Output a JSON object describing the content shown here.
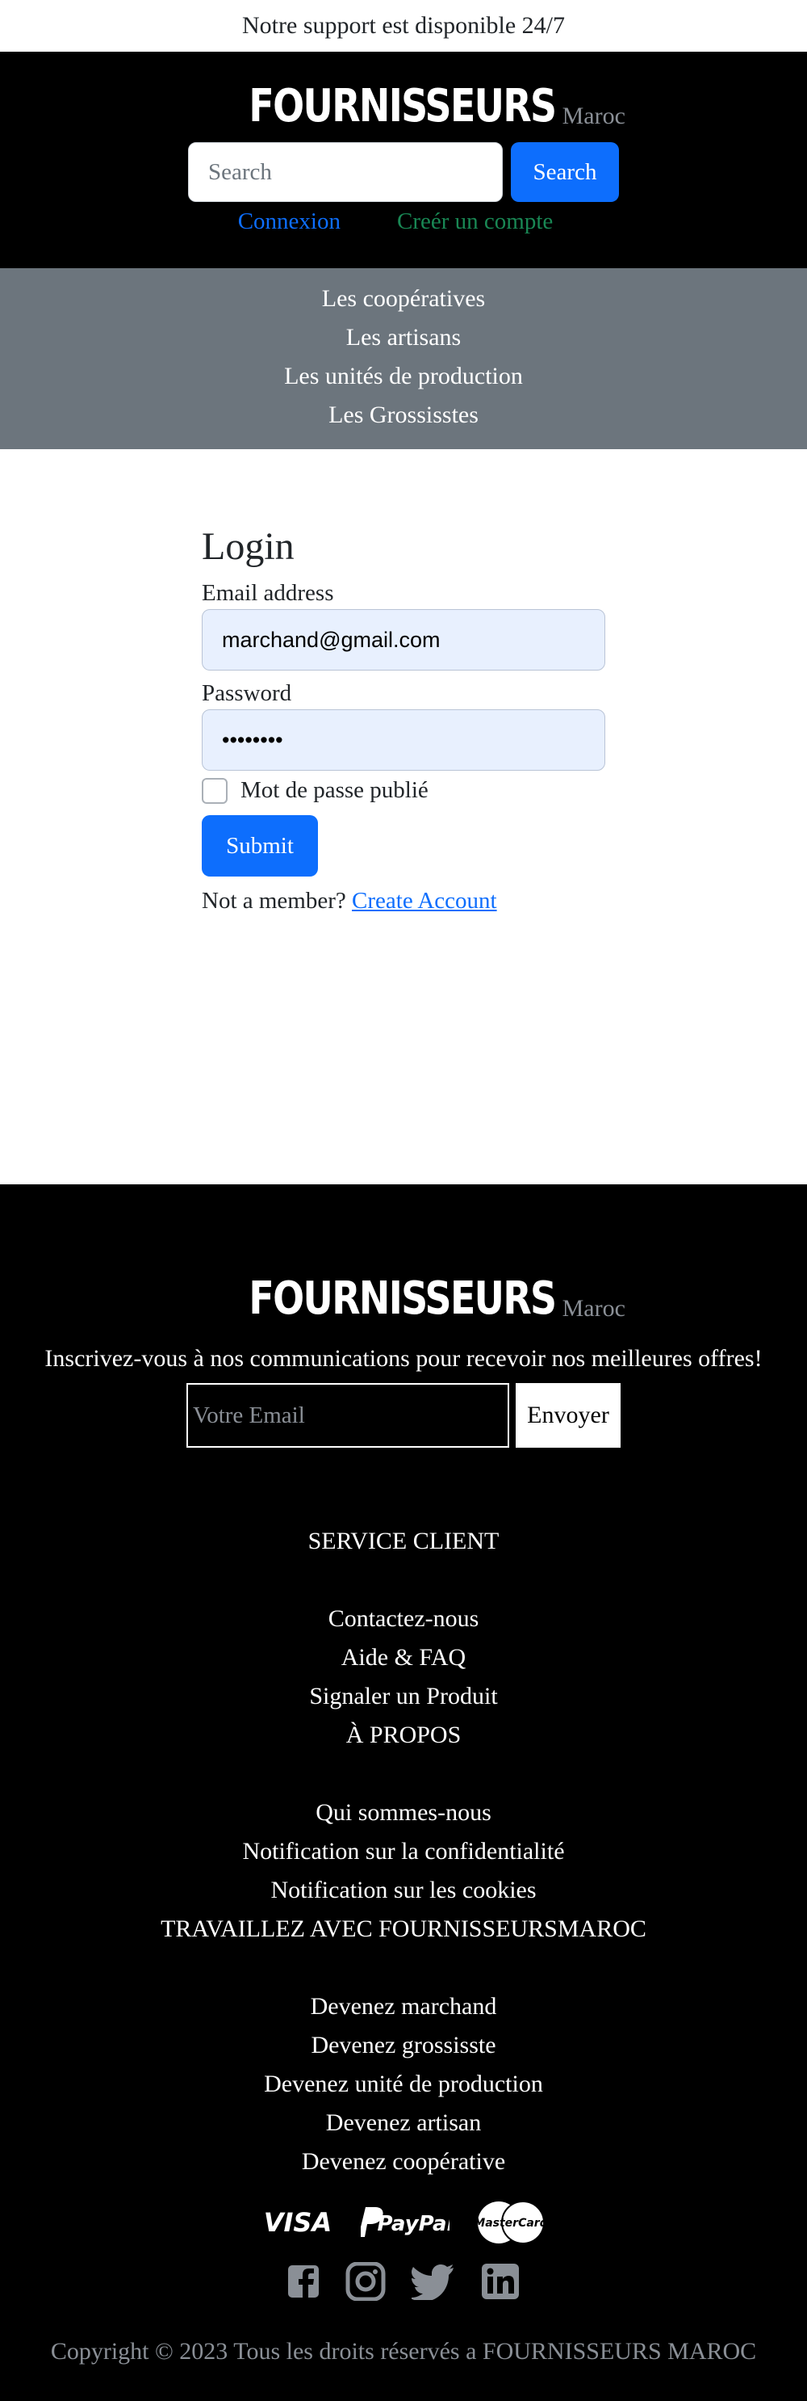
{
  "topbar": {
    "text": "Notre support est disponible 24/7"
  },
  "brand": {
    "name": "FOURNISSEURS",
    "suffix": "Maroc"
  },
  "header": {
    "search_placeholder": "Search",
    "search_button": "Search",
    "login_link": "Connexion",
    "register_link": "Creér un compte"
  },
  "categories": [
    "Les coopératives",
    "Les artisans",
    "Les unités de production",
    "Les Grossisstes"
  ],
  "login": {
    "title": "Login",
    "email_label": "Email address",
    "email_value": "marchand@gmail.com",
    "password_label": "Password",
    "password_value": "••••••••",
    "show_password_label": "Mot de passe publié",
    "submit": "Submit",
    "not_member": "Not a member?",
    "create_account": "Create Account"
  },
  "footer": {
    "newsletter_text": "Inscrivez-vous à nos communications pour recevoir nos meilleures offres!",
    "email_placeholder": "Votre Email",
    "send_button": "Envoyer",
    "service_heading": "SERVICE CLIENT",
    "service_links": [
      "Contactez-nous",
      "Aide & FAQ",
      "Signaler un Produit"
    ],
    "about_heading": "À PROPOS",
    "about_links": [
      "Qui sommes-nous",
      "Notification sur la confidentialité",
      "Notification sur les cookies"
    ],
    "work_heading": "TRAVAILLEZ AVEC FOURNISSEURSMAROC",
    "work_links": [
      "Devenez marchand",
      "Devenez grossisste",
      "Devenez unité de production",
      "Devenez artisan",
      "Devenez coopérative"
    ],
    "payments": {
      "visa": "VISA",
      "paypal": "PayPal",
      "mastercard": "MasterCard"
    },
    "copyright": "Copyright © 2023 Tous les droits réservés a FOURNISSEURS MAROC"
  },
  "icons": [
    "facebook-icon",
    "instagram-icon",
    "twitter-icon",
    "linkedin-icon"
  ]
}
